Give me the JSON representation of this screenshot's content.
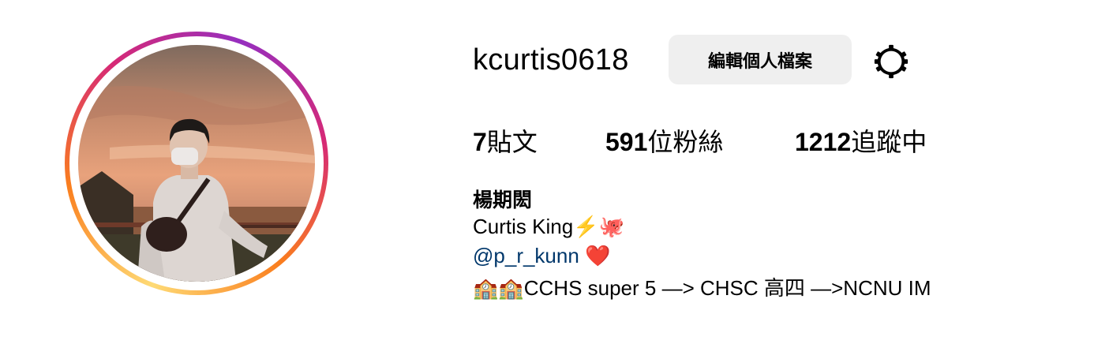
{
  "profile": {
    "username": "kcurtis0618",
    "edit_button_label": "編輯個人檔案",
    "settings_icon": "gear-icon",
    "stats": {
      "posts_count": "7",
      "posts_label": "貼文",
      "followers_count": "591",
      "followers_label": "位粉絲",
      "following_count": "1212",
      "following_label": "追蹤中"
    },
    "full_name": "楊期閎",
    "bio": {
      "line1": "Curtis King⚡️🐙",
      "mention": "@p_r_kunn",
      "mention_suffix": " ❤️",
      "line3": "🏫🏫CCHS super 5 —> CHSC 高四 —>NCNU IM"
    }
  },
  "colors": {
    "button_bg": "#efefef",
    "mention_link": "#00376b",
    "story_ring": [
      "#feda75",
      "#fa7e1e",
      "#d62976",
      "#962fbf"
    ]
  }
}
